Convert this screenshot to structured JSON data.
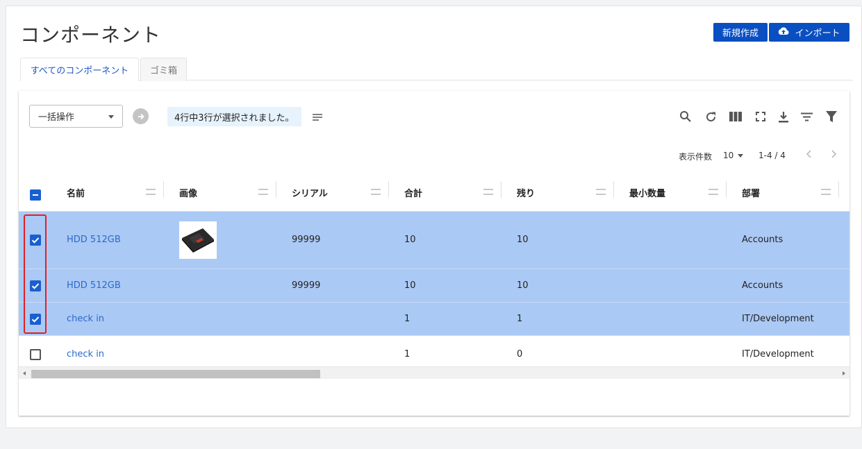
{
  "page": {
    "title": "コンポーネント"
  },
  "actions": {
    "new_label": "新規作成",
    "import_label": "インポート"
  },
  "tabs": [
    {
      "label": "すべてのコンポーネント",
      "active": true
    },
    {
      "label": "ゴミ箱",
      "active": false
    }
  ],
  "toolbar": {
    "bulk_action_label": "一括操作",
    "selection_info": "4行中3行が選択されました。",
    "icons": [
      "search-icon",
      "refresh-icon",
      "columns-icon",
      "fullscreen-icon",
      "download-icon",
      "filter-list-icon",
      "filter-icon"
    ]
  },
  "pagination": {
    "per_page_label": "表示件数",
    "per_page_value": "10",
    "range": "1-4 / 4"
  },
  "table": {
    "columns": [
      "名前",
      "画像",
      "シリアル",
      "合計",
      "残り",
      "最小数量",
      "部署"
    ],
    "rows": [
      {
        "selected": true,
        "name": "HDD 512GB",
        "has_image": true,
        "serial": "99999",
        "total": "10",
        "remaining": "10",
        "min_qty": "",
        "department": "Accounts"
      },
      {
        "selected": true,
        "name": "HDD 512GB",
        "has_image": false,
        "serial": "99999",
        "total": "10",
        "remaining": "10",
        "min_qty": "",
        "department": "Accounts"
      },
      {
        "selected": true,
        "name": "check in",
        "has_image": false,
        "serial": "",
        "total": "1",
        "remaining": "1",
        "min_qty": "",
        "department": "IT/Development"
      },
      {
        "selected": false,
        "name": "check in",
        "has_image": false,
        "serial": "",
        "total": "1",
        "remaining": "0",
        "min_qty": "",
        "department": "IT/Development"
      }
    ]
  },
  "colors": {
    "primary": "#0a4fc2",
    "selected_row": "#abc9f5",
    "link": "#2a6bc8",
    "highlight": "#e02020"
  }
}
